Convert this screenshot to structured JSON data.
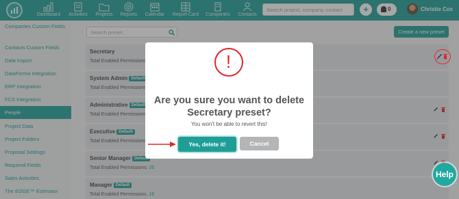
{
  "app": {
    "nav": [
      {
        "label": "Dashboard",
        "icon": "bar-chart-icon"
      },
      {
        "label": "Activities",
        "icon": "list-icon"
      },
      {
        "label": "Projects",
        "icon": "folder-icon"
      },
      {
        "label": "Reports",
        "icon": "target-icon"
      },
      {
        "label": "Calendar",
        "icon": "calendar-icon"
      },
      {
        "label": "Report Card",
        "icon": "grid-icon"
      },
      {
        "label": "Companies",
        "icon": "building-icon"
      },
      {
        "label": "Contacts",
        "icon": "person-icon"
      }
    ],
    "search_placeholder": "Search project, company, contact",
    "notification_count": "0",
    "user_name": "Christie Cox",
    "accent_color": "#1f9e97"
  },
  "sidebar": {
    "items": [
      {
        "label": "Companies Custom Fields",
        "active": false
      },
      {
        "label": "Contacts Custom Fields",
        "active": false
      },
      {
        "label": "Data Import",
        "active": false
      },
      {
        "label": "DataForma Integration",
        "active": false
      },
      {
        "label": "ERP Integration",
        "active": false
      },
      {
        "label": "FCS Integration",
        "active": false
      },
      {
        "label": "People",
        "active": true
      },
      {
        "label": "Project Data",
        "active": false
      },
      {
        "label": "Project Folders",
        "active": false
      },
      {
        "label": "Proposal Settings",
        "active": false
      },
      {
        "label": "Required Fields",
        "active": false
      },
      {
        "label": "Sales Activities",
        "active": false
      },
      {
        "label": "The EDGE™ Estimator",
        "active": false
      }
    ]
  },
  "main": {
    "preset_search_placeholder": "Search preset...",
    "create_button": "Create a new preset",
    "perm_label": "Total Enabled Permissions:",
    "presets": [
      {
        "name": "Secretary",
        "badge": "",
        "count": ""
      },
      {
        "name": "System Admin",
        "badge": "Default",
        "count": ""
      },
      {
        "name": "Administrative",
        "badge": "Default",
        "count": ""
      },
      {
        "name": "Executive",
        "badge": "Default",
        "count": ""
      },
      {
        "name": "Senior Manager",
        "badge": "Default",
        "count": "26"
      },
      {
        "name": "Manager",
        "badge": "Default",
        "count": "18"
      }
    ]
  },
  "modal": {
    "icon": "exclamation-icon",
    "title_line1": "Are you sure you want to delete",
    "title_line2": "Secretary preset?",
    "subtitle": "You won't be able to revert this!",
    "confirm": "Yes, delete it!",
    "cancel": "Cancel"
  },
  "help": "Help"
}
